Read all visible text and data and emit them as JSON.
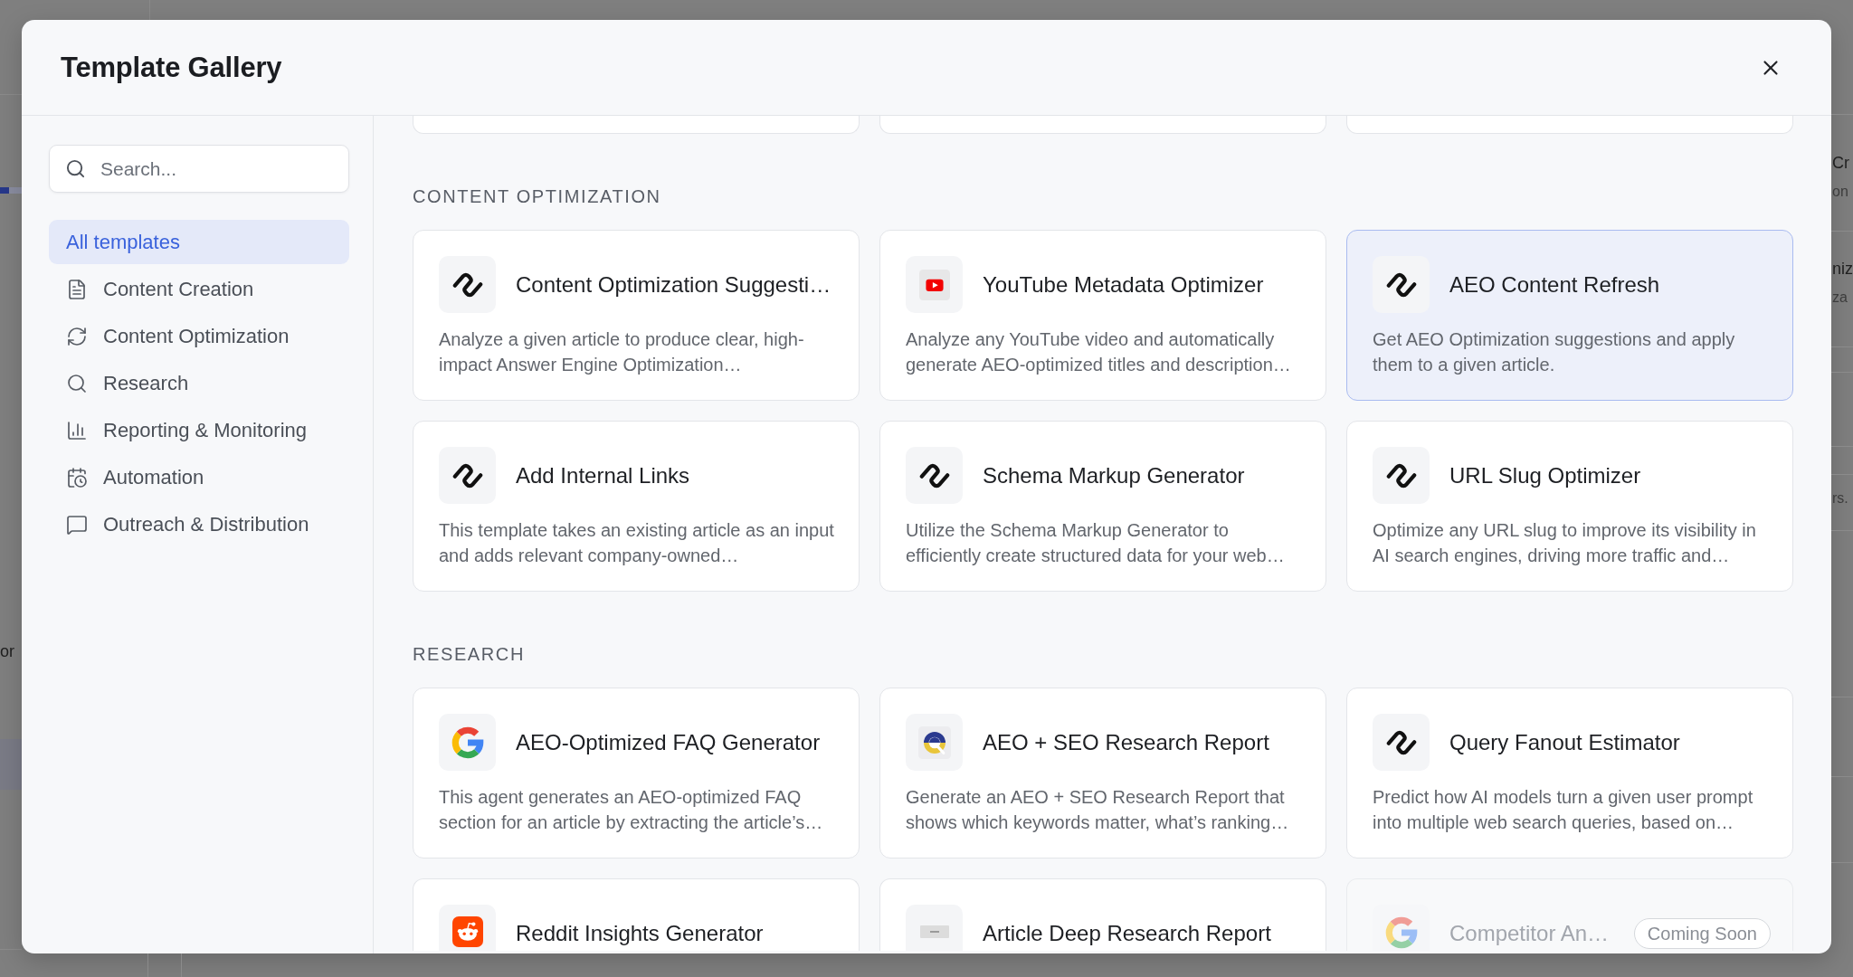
{
  "background_page": {
    "left_edge_texts": [
      "or"
    ],
    "right_edge_texts": [
      "Cr",
      "on",
      "niz",
      "za",
      "rs."
    ]
  },
  "dialog": {
    "title": "Template Gallery"
  },
  "sidebar": {
    "search": {
      "placeholder": "Search..."
    },
    "items": [
      {
        "label": "All templates",
        "selected": true
      },
      {
        "label": "Content Creation",
        "selected": false
      },
      {
        "label": "Content Optimization",
        "selected": false
      },
      {
        "label": "Research",
        "selected": false
      },
      {
        "label": "Reporting & Monitoring",
        "selected": false
      },
      {
        "label": "Automation",
        "selected": false
      },
      {
        "label": "Outreach & Distribution",
        "selected": false
      }
    ]
  },
  "sections": [
    {
      "cards": [
        {
          "selected": false
        },
        {
          "selected": false
        },
        {
          "selected": false
        }
      ]
    },
    {
      "heading": "CONTENT OPTIMIZATION",
      "cards": [
        {
          "title": "Content Optimization Suggesti…",
          "description": "Analyze a given article to produce clear, high-impact Answer Engine Optimization…",
          "selected": false,
          "disabled": false
        },
        {
          "title": "YouTube Metadata Optimizer",
          "description": "Analyze any YouTube video and automatically generate AEO-optimized titles and description…",
          "selected": false,
          "disabled": false
        },
        {
          "title": "AEO Content Refresh",
          "description": "Get AEO Optimization suggestions and apply them to a given article.",
          "selected": true,
          "disabled": false
        },
        {
          "title": "Add Internal Links",
          "description": "This template takes an existing article as an input and adds relevant company-owned…",
          "selected": false,
          "disabled": false
        },
        {
          "title": "Schema Markup Generator",
          "description": "Utilize the Schema Markup Generator to efficiently create structured data for your web…",
          "selected": false,
          "disabled": false
        },
        {
          "title": "URL Slug Optimizer",
          "description": "Optimize any URL slug to improve its visibility in AI search engines, driving more traffic and…",
          "selected": false,
          "disabled": false
        }
      ]
    },
    {
      "heading": "RESEARCH",
      "cards": [
        {
          "title": "AEO-Optimized FAQ Generator",
          "description": "This agent generates an AEO-optimized FAQ section for an article by extracting the article’s…",
          "selected": false,
          "disabled": false
        },
        {
          "title": "AEO + SEO Research Report",
          "description": "Generate an AEO + SEO Research Report that shows which keywords matter, what’s ranking…",
          "selected": false,
          "disabled": false
        },
        {
          "title": "Query Fanout Estimator",
          "description": "Predict how AI models turn a given user prompt into multiple web search queries, based on…",
          "selected": false,
          "disabled": false
        },
        {
          "title": "Reddit Insights Generator",
          "selected": false,
          "disabled": false
        },
        {
          "title": "Article Deep Research Report",
          "selected": false,
          "disabled": false
        },
        {
          "title": "Competitor An…",
          "badge": "Coming Soon",
          "selected": false,
          "disabled": true
        }
      ]
    }
  ]
}
